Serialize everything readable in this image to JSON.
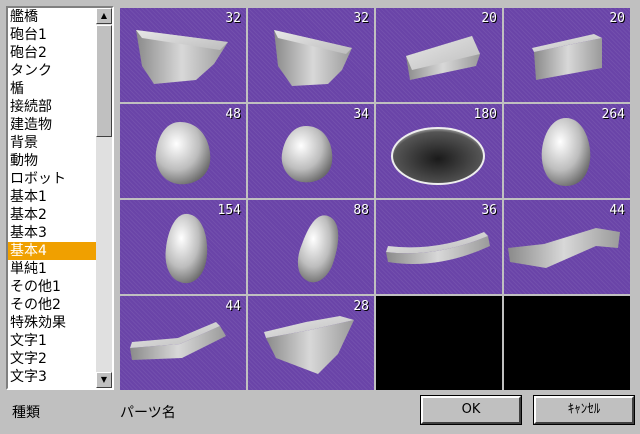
{
  "categories": {
    "items": [
      "艦橋",
      "砲台1",
      "砲台2",
      "タンク",
      "楯",
      "接続部",
      "建造物",
      "背景",
      "動物",
      "ロボット",
      "基本1",
      "基本2",
      "基本3",
      "基本4",
      "単純1",
      "その他1",
      "その他2",
      "特殊効果",
      "文字1",
      "文字2",
      "文字3"
    ],
    "selected_index": 13
  },
  "scrollbar": {
    "up_arrow": "▲",
    "down_arrow": "▼"
  },
  "parts": [
    {
      "count": "32",
      "shape": "half-disc-tall"
    },
    {
      "count": "32",
      "shape": "half-disc-short"
    },
    {
      "count": "20",
      "shape": "wedge-flat"
    },
    {
      "count": "20",
      "shape": "wedge-box"
    },
    {
      "count": "48",
      "shape": "blob"
    },
    {
      "count": "34",
      "shape": "blob-low"
    },
    {
      "count": "180",
      "shape": "ellipse-bowl"
    },
    {
      "count": "264",
      "shape": "egg"
    },
    {
      "count": "154",
      "shape": "egg-lean"
    },
    {
      "count": "88",
      "shape": "egg-tilted"
    },
    {
      "count": "36",
      "shape": "arc-band-thin"
    },
    {
      "count": "44",
      "shape": "arc-band-thick"
    },
    {
      "count": "44",
      "shape": "arc-band-long"
    },
    {
      "count": "28",
      "shape": "wedge-quarter"
    },
    {
      "count": "",
      "shape": "empty"
    },
    {
      "count": "",
      "shape": "empty"
    }
  ],
  "footer": {
    "kind_label": "種類",
    "part_name_label": "パーツ名",
    "ok_label": "OK",
    "cancel_label": "ｷｬﾝｾﾙ"
  },
  "colors": {
    "tile_bg": "#6a44a8",
    "selection": "#f0a000"
  }
}
